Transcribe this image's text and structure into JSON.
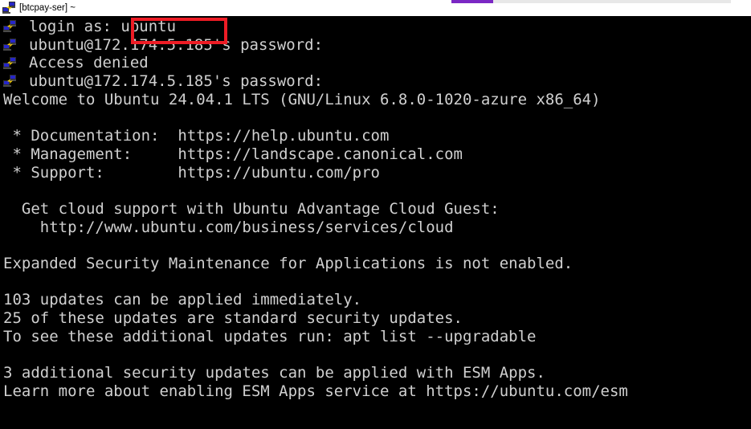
{
  "window": {
    "title": "[btcpay-ser] ~",
    "icon": "putty-network-icon",
    "titlebar_bg": "#ffffff",
    "terminal_bg": "#000000",
    "terminal_fg": "#d0d0d0"
  },
  "progress": {
    "name": "page-load-progress",
    "percent": 15,
    "fill_color": "#7b28c4",
    "track_color": "#e8e8e8"
  },
  "annotation": {
    "name": "red-highlight-box",
    "color": "#ee1c25",
    "targets_text": "ubuntu"
  },
  "terminal": {
    "prompt_icon": "putty-network-icon",
    "lines": [
      {
        "icon": true,
        "text": "login as: ubuntu"
      },
      {
        "icon": true,
        "text": "ubuntu@172.174.5.185's password:"
      },
      {
        "icon": true,
        "text": "Access denied"
      },
      {
        "icon": true,
        "text": "ubuntu@172.174.5.185's password:"
      },
      {
        "icon": false,
        "text": "Welcome to Ubuntu 24.04.1 LTS (GNU/Linux 6.8.0-1020-azure x86_64)"
      },
      {
        "icon": false,
        "text": ""
      },
      {
        "icon": false,
        "text": " * Documentation:  https://help.ubuntu.com"
      },
      {
        "icon": false,
        "text": " * Management:     https://landscape.canonical.com"
      },
      {
        "icon": false,
        "text": " * Support:        https://ubuntu.com/pro"
      },
      {
        "icon": false,
        "text": ""
      },
      {
        "icon": false,
        "text": "  Get cloud support with Ubuntu Advantage Cloud Guest:"
      },
      {
        "icon": false,
        "text": "    http://www.ubuntu.com/business/services/cloud"
      },
      {
        "icon": false,
        "text": ""
      },
      {
        "icon": false,
        "text": "Expanded Security Maintenance for Applications is not enabled."
      },
      {
        "icon": false,
        "text": ""
      },
      {
        "icon": false,
        "text": "103 updates can be applied immediately."
      },
      {
        "icon": false,
        "text": "25 of these updates are standard security updates."
      },
      {
        "icon": false,
        "text": "To see these additional updates run: apt list --upgradable"
      },
      {
        "icon": false,
        "text": ""
      },
      {
        "icon": false,
        "text": "3 additional security updates can be applied with ESM Apps."
      },
      {
        "icon": false,
        "text": "Learn more about enabling ESM Apps service at https://ubuntu.com/esm"
      },
      {
        "icon": false,
        "text": ""
      }
    ]
  }
}
